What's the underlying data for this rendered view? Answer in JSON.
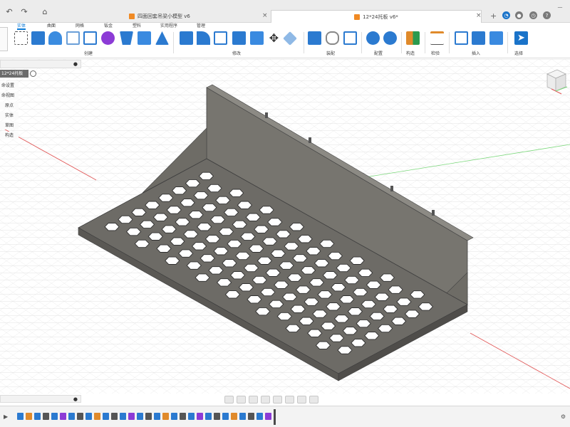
{
  "tabs": [
    {
      "label": "四面回套吊梁小模型 v6",
      "active": false
    },
    {
      "label": "12*24托板 v6*",
      "active": true
    }
  ],
  "ribbon": {
    "tabs": [
      "实体",
      "曲面",
      "网格",
      "钣金",
      "塑料",
      "实用程序",
      "管理"
    ],
    "groups": [
      "创建",
      "修改",
      "装配",
      "配置",
      "构造",
      "检验",
      "插入",
      "选择"
    ]
  },
  "browser": {
    "file": "12*24托板 v6",
    "items": [
      "命设置",
      "命视图",
      "原点",
      "实体",
      "草图",
      "构造"
    ]
  },
  "colors": {
    "accent": "#0a7ad6",
    "model": "#6d6b66",
    "bg": "#ffffff"
  }
}
